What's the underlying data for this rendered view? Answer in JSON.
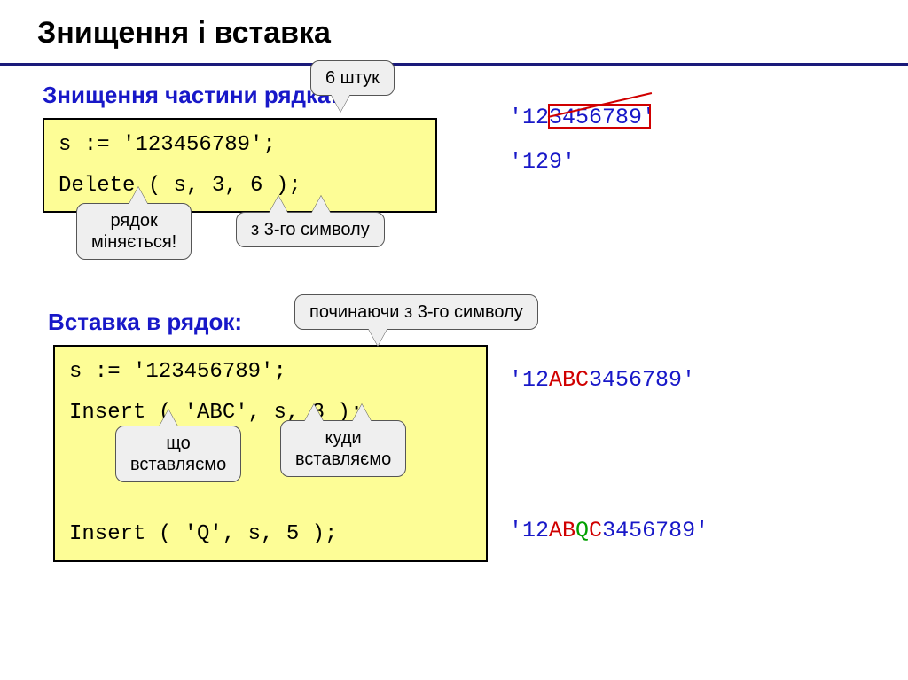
{
  "title": "Знищення і вставка",
  "section1": {
    "heading": "Знищення частини рядка:",
    "code_line1": "s := '123456789';",
    "code_line2": "Delete ( s, 3, 6 );",
    "callout_6": "6 штук",
    "callout_changes": "рядок\nміняється!",
    "callout_from3": "з 3-го символу",
    "result_full": "'123456789'",
    "result_after": "'129'"
  },
  "section2": {
    "heading": "Вставка в рядок:",
    "code_line1": "s := '123456789';",
    "code_line2": "Insert ( 'ABC', s, 3 );",
    "code_line3": "Insert ( 'Q', s, 5 );",
    "callout_start3": "починаючи з 3-го символу",
    "callout_what": "що\nвставляємо",
    "callout_where": "куди\nвставляємо",
    "result_abc_pre": "'12",
    "result_abc_mid": "ABC",
    "result_abc_post": "3456789'",
    "result_q_pre": "'12",
    "result_q_ab": "AB",
    "result_q_q": "Q",
    "result_q_c": "C",
    "result_q_post": "3456789'"
  }
}
